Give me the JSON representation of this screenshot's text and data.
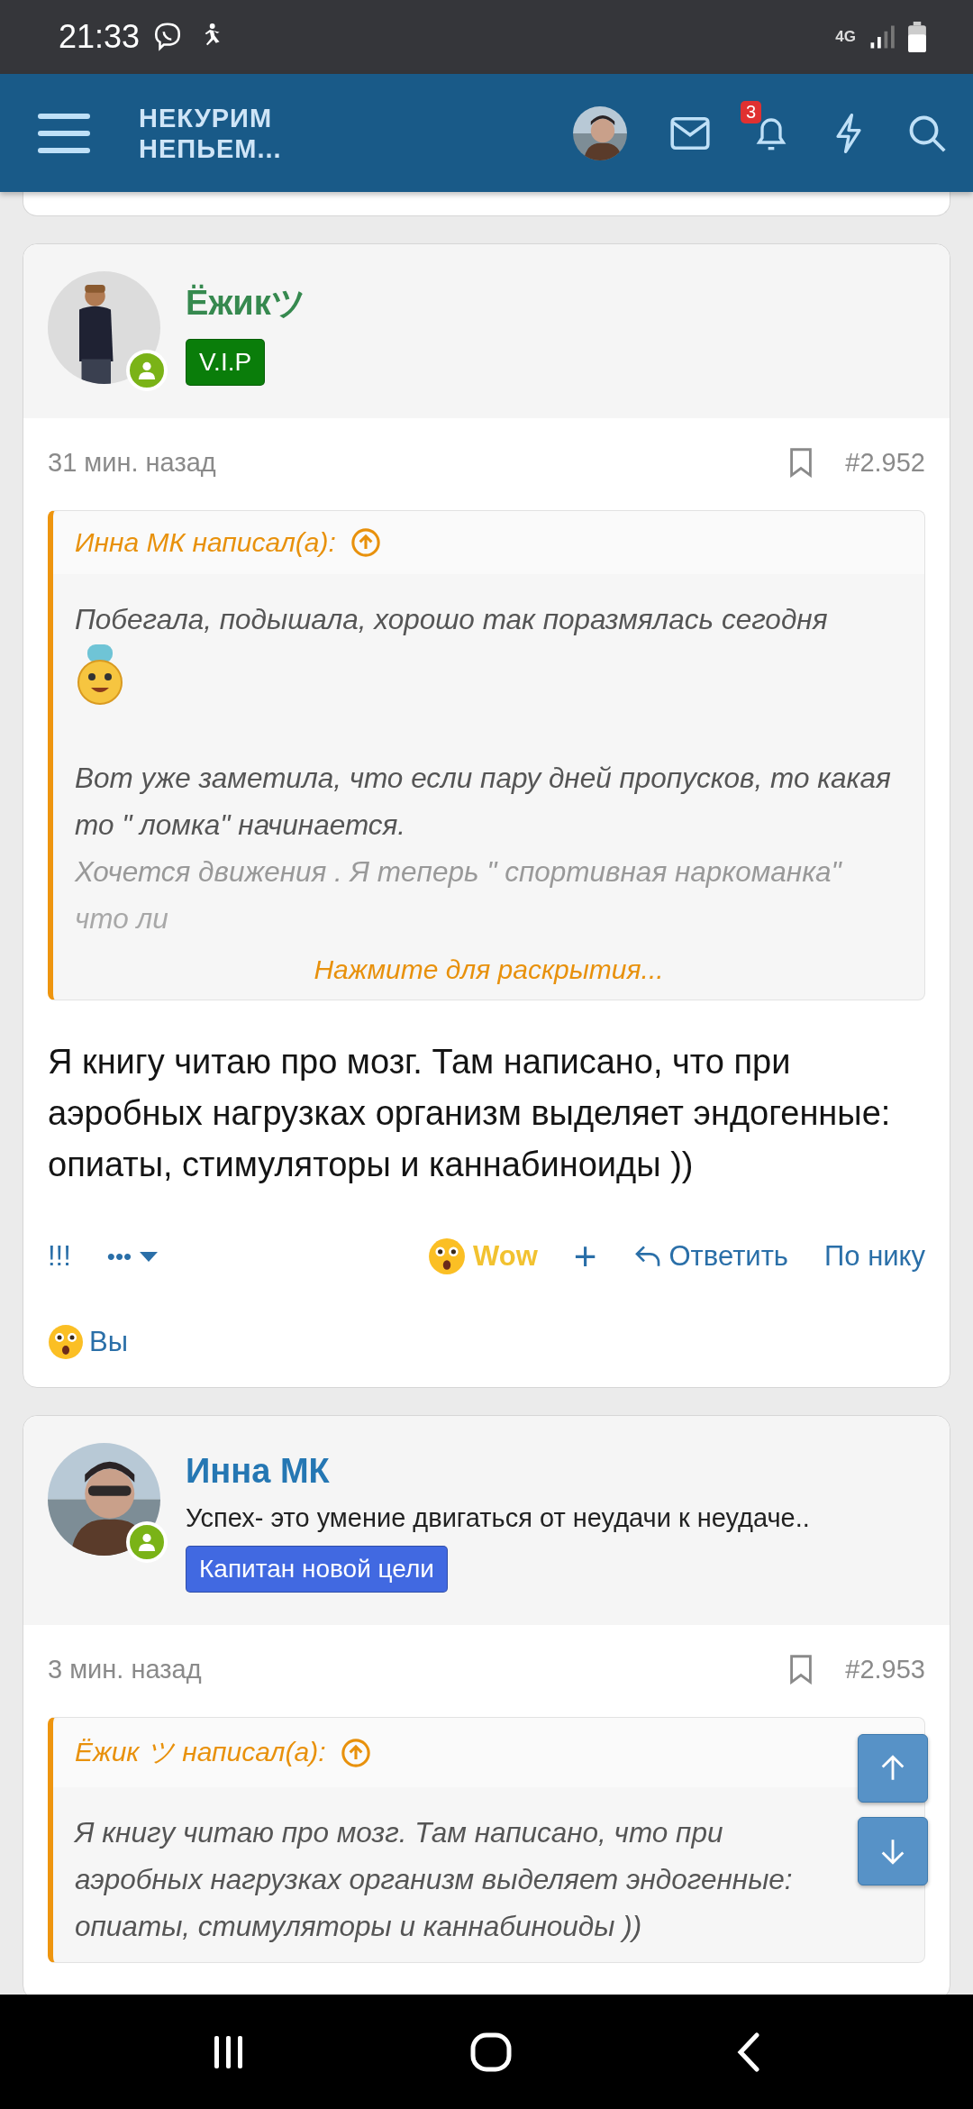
{
  "status_bar": {
    "time": "21:33",
    "network": "4G"
  },
  "header": {
    "logo_lines": [
      "НЕКУРИМ",
      "НЕПЬЕМ..."
    ],
    "notification_count": "3"
  },
  "posts": [
    {
      "author": "Ёжикツ",
      "color": "#36894f",
      "online": true,
      "badge": {
        "text": "V.I.P",
        "color": "#0a7d0a"
      },
      "time": "31 мин. назад",
      "number": "#2.952",
      "quote": {
        "author_line": "Инна МК написал(а):",
        "collapsed": true,
        "expand": "Нажмите для раскрытия...",
        "lines": [
          {
            "kind": "text",
            "text": "Побегала, подышала, хорошо так поразмялась сегодня"
          },
          {
            "kind": "emoji"
          },
          {
            "kind": "text",
            "text": "Вот уже заметила, что если пару дней пропусков, то какая то \" ломка\" начинается."
          },
          {
            "kind": "text",
            "text": "Хочется движения . Я теперь \" спортивная наркоманка\""
          },
          {
            "kind": "text",
            "text": "что ли"
          }
        ]
      },
      "body": "Я книгу читаю про мозг. Там написано, что при аэробных нагрузках организм выделяет эндогенные: опиаты, стимуляторы и каннабиноиды ))",
      "actions": {
        "left": [
          {
            "kind": "text",
            "label": "!!!"
          },
          {
            "kind": "menu",
            "label": "•••"
          }
        ],
        "right": [
          {
            "kind": "reaction",
            "label": "Wow",
            "selected": true
          },
          {
            "kind": "plus",
            "label": "+"
          },
          {
            "kind": "reply",
            "label": "Ответить"
          },
          {
            "kind": "text",
            "label": "По нику"
          }
        ]
      },
      "reacted_by": "Вы"
    },
    {
      "author": "Инна МК",
      "color": "#2577b3",
      "online": true,
      "user_title": "Успех- это умение двигаться от неудачи к неудаче..",
      "badge": {
        "text": "Капитан новой цели",
        "color": "#4169e1"
      },
      "time": "3 мин. назад",
      "number": "#2.953",
      "quote": {
        "author_line": "Ёжик ツ написал(а):",
        "collapsed": false,
        "lines": [
          {
            "kind": "text",
            "text": "Я книгу читаю про мозг. Там написано, что при аэробных нагрузках организм выделяет эндогенные: опиаты, стимуляторы и каннабиноиды ))"
          }
        ]
      }
    }
  ]
}
